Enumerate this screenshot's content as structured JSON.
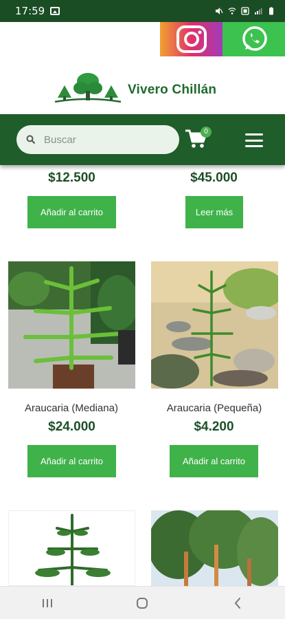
{
  "status_bar": {
    "time": "17:59"
  },
  "brand": {
    "name": "Vivero Chillán"
  },
  "search": {
    "placeholder": "Buscar"
  },
  "cart": {
    "count": "0"
  },
  "products": [
    {
      "price": "$12.500",
      "button": "Añadir al carrito"
    },
    {
      "price": "$45.000",
      "button": "Leer más"
    },
    {
      "name": "Araucaria (Mediana)",
      "price": "$24.000",
      "button": "Añadir al carrito"
    },
    {
      "name": "Araucaria (Pequeña)",
      "price": "$4.200",
      "button": "Añadir al carrito"
    }
  ],
  "colors": {
    "brand_green": "#1f5d2a",
    "button_green": "#3fb24a",
    "price_text": "#1e4f28"
  },
  "icons": [
    "instagram-icon",
    "whatsapp-icon",
    "search-icon",
    "cart-icon",
    "menu-icon",
    "recents-icon",
    "home-icon",
    "back-icon"
  ]
}
